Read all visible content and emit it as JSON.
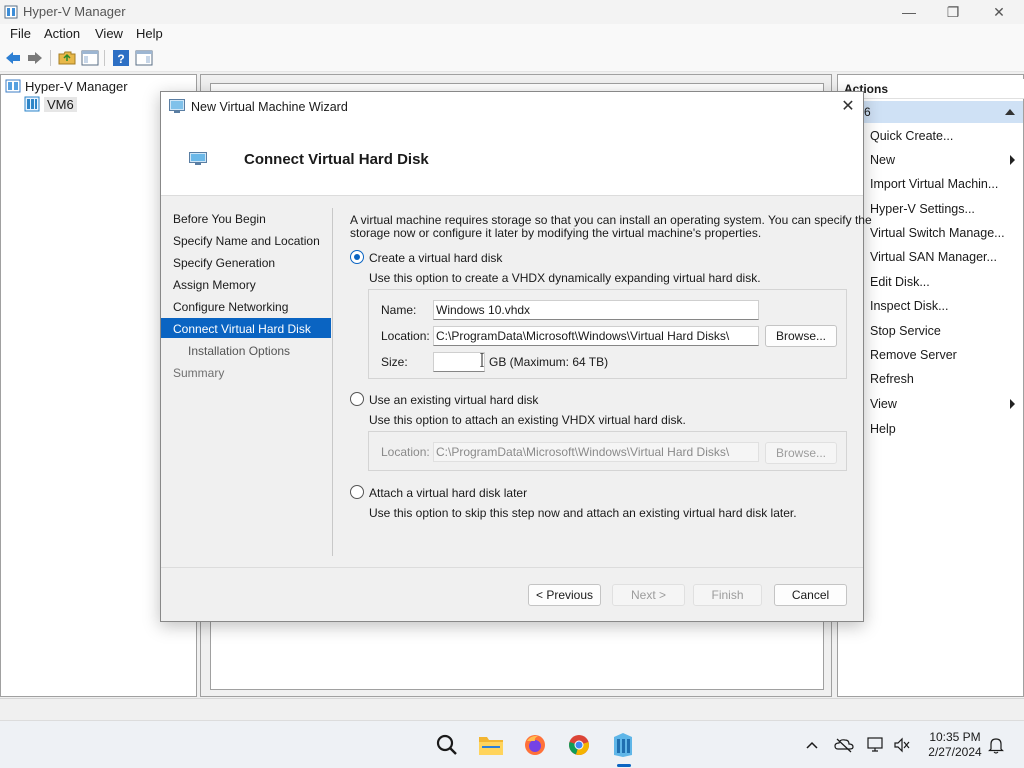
{
  "window": {
    "title": "Hyper-V Manager",
    "controls": {
      "minimize": "—",
      "maximize": "❐",
      "close": "✕"
    }
  },
  "menu": [
    "File",
    "Action",
    "View",
    "Help"
  ],
  "tree": {
    "root": "Hyper-V Manager",
    "child": "VM6"
  },
  "actions": {
    "header": "Actions",
    "subheader": "6",
    "items": [
      "Quick Create...",
      "New",
      "Import Virtual Machin...",
      "Hyper-V Settings...",
      "Virtual Switch Manage...",
      "Virtual SAN Manager...",
      "Edit Disk...",
      "Inspect Disk...",
      "Stop Service",
      "Remove Server",
      "Refresh",
      "View",
      "Help"
    ]
  },
  "wizard": {
    "title": "New Virtual Machine Wizard",
    "close": "✕",
    "heading": "Connect Virtual Hard Disk",
    "nav": [
      "Before You Begin",
      "Specify Name and Location",
      "Specify Generation",
      "Assign Memory",
      "Configure Networking",
      "Connect Virtual Hard Disk",
      "Installation Options",
      "Summary"
    ],
    "intro_line1": "A virtual machine requires storage so that you can install an operating system. You can specify the",
    "intro_line2": "storage now or configure it later by modifying the virtual machine's properties.",
    "option_create": {
      "label": "Create a virtual hard disk",
      "desc": "Use this option to create a VHDX dynamically expanding virtual hard disk.",
      "name_label": "Name:",
      "name_value": "Windows 10.vhdx",
      "location_label": "Location:",
      "location_value": "C:\\ProgramData\\Microsoft\\Windows\\Virtual Hard Disks\\",
      "browse": "Browse...",
      "size_label": "Size:",
      "size_value": "",
      "size_suffix": "GB (Maximum: 64 TB)"
    },
    "option_existing": {
      "label": "Use an existing virtual hard disk",
      "desc": "Use this option to attach an existing VHDX virtual hard disk.",
      "location_label": "Location:",
      "location_value": "C:\\ProgramData\\Microsoft\\Windows\\Virtual Hard Disks\\",
      "browse": "Browse..."
    },
    "option_later": {
      "label": "Attach a virtual hard disk later",
      "desc": "Use this option to skip this step now and attach an existing virtual hard disk later."
    },
    "buttons": {
      "previous": "< Previous",
      "next": "Next >",
      "finish": "Finish",
      "cancel": "Cancel"
    }
  },
  "taskbar": {
    "time": "10:35 PM",
    "date": "2/27/2024"
  },
  "colors": {
    "accent": "#0a64c2",
    "actions_selected": "#cfe1f5"
  }
}
